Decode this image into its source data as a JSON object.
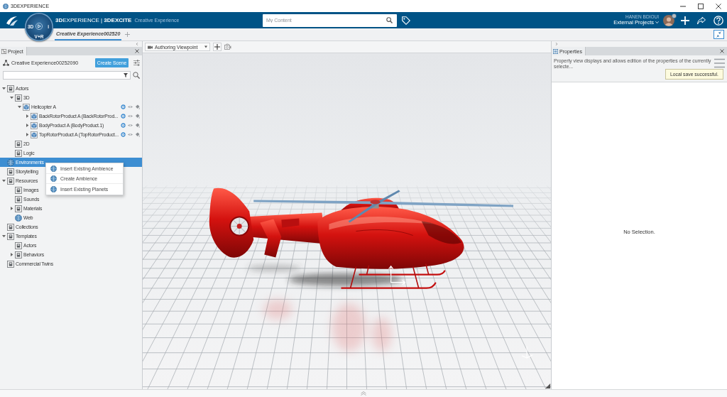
{
  "window": {
    "title": "3DEXPERIENCE"
  },
  "top_bar": {
    "brand": "**3D**EXPERIENCE | **3DEXCITE**",
    "app_name": "Creative Experience",
    "compass_labels": [
      "3D",
      "i",
      "V+R"
    ],
    "search": {
      "placeholder": "My Content"
    },
    "user_name": "HANEN BDIOUI",
    "collab_space": "External Projects"
  },
  "tabs": [
    {
      "label": "Creative Experience002520",
      "selected": true
    }
  ],
  "project_panel": {
    "title": "Project",
    "experience": "Creative Experience00252090",
    "create_button": "Create Scene",
    "tree": [
      {
        "label": "Actors",
        "kind": "folder",
        "expanded": true,
        "selected": false,
        "children": [
          {
            "label": "3D",
            "kind": "folder",
            "expanded": true,
            "selected": false,
            "children": [
              {
                "label": "Helicopter A",
                "kind": "part",
                "expanded": true,
                "selected": false,
                "children": [
                  {
                    "label": "BackRotorProduct A (BackRotorProd...",
                    "kind": "part",
                    "expanded": false,
                    "selected": false
                  },
                  {
                    "label": "BodyProduct A (BodyProduct.1)",
                    "kind": "part",
                    "expanded": false,
                    "selected": false
                  },
                  {
                    "label": "TopRotorProduct A (TopRotorProduct...",
                    "kind": "part",
                    "expanded": false,
                    "selected": false
                  }
                ]
              }
            ]
          },
          {
            "label": "2D",
            "kind": "folder",
            "selected": false
          },
          {
            "label": "Logic",
            "kind": "folder",
            "selected": false
          }
        ]
      },
      {
        "label": "Environments",
        "kind": "globe",
        "selected": true
      },
      {
        "label": "Storytelling",
        "kind": "folder",
        "selected": false
      },
      {
        "label": "Resources",
        "kind": "folder",
        "expanded": true,
        "selected": false,
        "children": [
          {
            "label": "Images",
            "kind": "folder",
            "selected": false
          },
          {
            "label": "Sounds",
            "kind": "folder",
            "selected": false
          },
          {
            "label": "Materials",
            "kind": "folder",
            "expanded": false,
            "selected": false
          },
          {
            "label": "Web",
            "kind": "globe",
            "selected": false
          }
        ]
      },
      {
        "label": "Collections",
        "kind": "folder",
        "selected": false
      },
      {
        "label": "Templates",
        "kind": "folder",
        "expanded": true,
        "selected": false,
        "children": [
          {
            "label": "Actors",
            "kind": "folder",
            "selected": false
          },
          {
            "label": "Behaviors",
            "kind": "folder",
            "expanded": false,
            "selected": false
          }
        ]
      },
      {
        "label": "Commercial Twins",
        "kind": "folder",
        "selected": false
      }
    ]
  },
  "context_menu": [
    {
      "label": "Insert Existing Ambience"
    },
    {
      "label": "Create Ambience"
    },
    {
      "label": "Insert Existing Planets"
    }
  ],
  "viewport": {
    "viewpoint": "Authoring Viewpoint"
  },
  "properties_panel": {
    "title": "Properties",
    "description": "Property view displays and allows edition of the properties of the currently selecte...",
    "toast": "Local save successful.",
    "empty_message": "No Selection."
  }
}
